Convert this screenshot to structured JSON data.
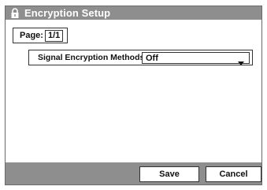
{
  "window": {
    "title": "Encryption Setup",
    "icon": "lock-icon"
  },
  "page": {
    "label": "Page:",
    "value": "1/1"
  },
  "settings": {
    "signal_encryption": {
      "label": "Signal Encryption Methods",
      "selected": "Off"
    }
  },
  "footer": {
    "save_label": "Save",
    "cancel_label": "Cancel"
  }
}
